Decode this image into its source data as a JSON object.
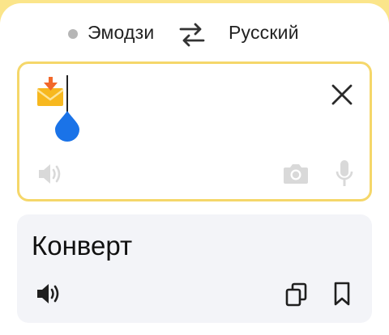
{
  "language_bar": {
    "source_language": "Эмодзи",
    "target_language": "Русский"
  },
  "input": {
    "emoji": "incoming-envelope-emoji",
    "icons": {
      "clear": "close-icon",
      "speak": "speaker-icon",
      "camera": "camera-icon",
      "mic": "microphone-icon"
    }
  },
  "output": {
    "translation": "Конверт",
    "icons": {
      "speak": "speaker-icon",
      "copy": "copy-icon",
      "bookmark": "bookmark-icon"
    }
  },
  "colors": {
    "accent_yellow": "#fbe58a",
    "input_border": "#f5d76a",
    "cursor_handle": "#1a73e8",
    "output_bg": "#f3f4f8"
  }
}
